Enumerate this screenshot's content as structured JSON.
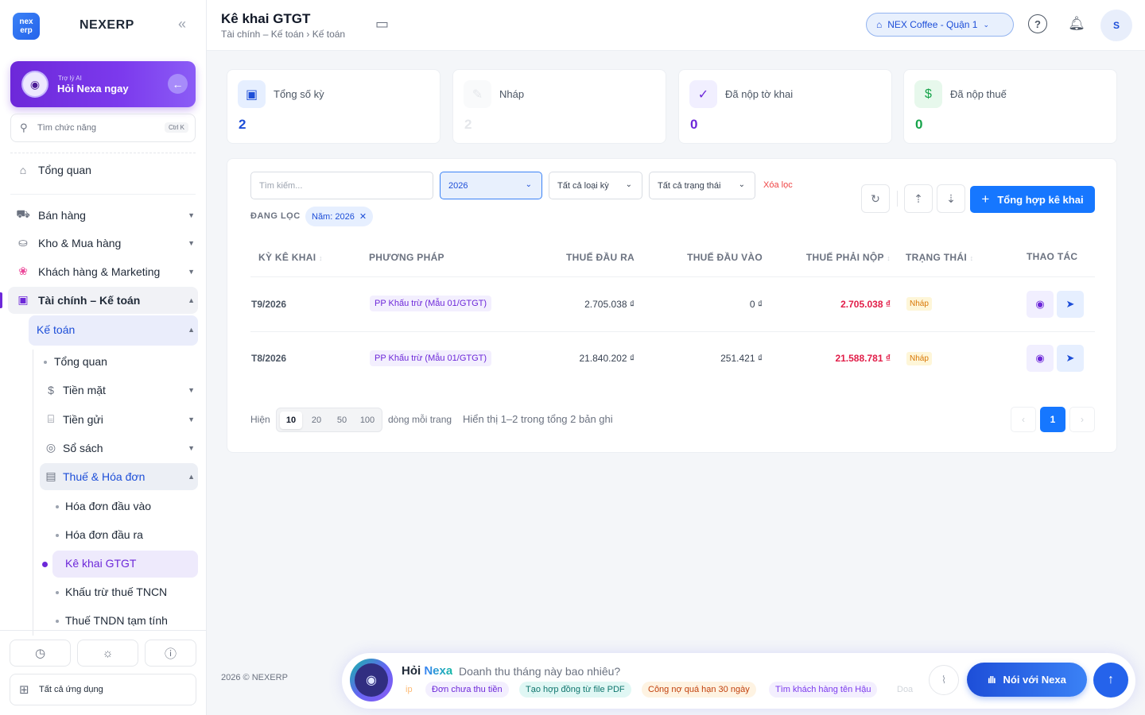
{
  "brand": {
    "logo": "nex erp",
    "name": "NEXERP"
  },
  "ai": {
    "small": "Trợ lý AI",
    "big": "Hỏi Nexa ngay"
  },
  "search": {
    "placeholder": "Tìm chức năng",
    "shortcut": "Ctrl K"
  },
  "nav": {
    "overview": "Tổng quan",
    "sales": "Bán hàng",
    "inventory": "Kho & Mua hàng",
    "customers": "Khách hàng & Marketing",
    "finance": "Tài chính – Kế toán",
    "accounting": "Kế toán",
    "acc_overview": "Tổng quan",
    "cash": "Tiền mặt",
    "deposit": "Tiền gửi",
    "books": "Sổ sách",
    "tax": "Thuế & Hóa đơn",
    "in_invoice": "Hóa đơn đầu vào",
    "out_invoice": "Hóa đơn đầu ra",
    "vat": "Kê khai GTGT",
    "pit": "Khấu trừ thuế TNCN",
    "cit": "Thuế TNDN tạm tính"
  },
  "sidebar_bottom": {
    "all_apps": "Tất cả ứng dụng"
  },
  "header": {
    "title": "Kê khai GTGT",
    "breadcrumb": "Tài chính – Kế toán › Kế toán",
    "store": "NEX Coffee - Quận 1",
    "avatar": "S"
  },
  "stats": [
    {
      "label": "Tổng số kỳ",
      "value": "2",
      "color": "#1d4ed8"
    },
    {
      "label": "Nháp",
      "value": "2",
      "color": "#d1d5db"
    },
    {
      "label": "Đã nộp tờ khai",
      "value": "0",
      "color": "#6d28d9"
    },
    {
      "label": "Đã nộp thuế",
      "value": "0",
      "color": "#16a34a"
    }
  ],
  "filters": {
    "search_placeholder": "Tìm kiếm...",
    "year": "2026",
    "period_type": "Tất cả loại kỳ",
    "status": "Tất cả trạng thái",
    "clear": "Xóa lọc",
    "filtering_label": "ĐANG LỌC",
    "chip": "Năm: 2026"
  },
  "toolbar": {
    "primary": "Tổng hợp kê khai"
  },
  "table": {
    "headers": [
      "KỲ KÊ KHAI",
      "PHƯƠNG PHÁP",
      "THUẾ ĐẦU RA",
      "THUẾ ĐẦU VÀO",
      "THUẾ PHẢI NỘP",
      "TRẠNG THÁI",
      "THAO TÁC"
    ],
    "rows": [
      {
        "period": "T9/2026",
        "method": "PP Khấu trừ (Mẫu 01/GTGT)",
        "out": "2.705.038 ₫",
        "in": "0 ₫",
        "pay": "2.705.038 ₫",
        "status": "Nháp"
      },
      {
        "period": "T8/2026",
        "method": "PP Khấu trừ (Mẫu 01/GTGT)",
        "out": "21.840.202 ₫",
        "in": "251.421 ₫",
        "pay": "21.588.781 ₫",
        "status": "Nháp"
      }
    ]
  },
  "pagination": {
    "show_label": "Hiện",
    "sizes": [
      "10",
      "20",
      "50",
      "100"
    ],
    "per_page": "dòng mỗi trang",
    "summary": "Hiển thị 1–2 trong tổng 2 bản ghi",
    "current": "1"
  },
  "footer": {
    "copyright": "2026 © NEXERP"
  },
  "nexa": {
    "ask": "Hỏi",
    "name": "Nexa",
    "question": "Doanh thu tháng này bao nhiêu?",
    "suggestions": [
      "ip",
      "Đơn chưa thu tiền",
      "Tạo hợp đồng từ file PDF",
      "Công nợ quá hạn 30 ngày",
      "Tìm khách hàng tên Hậu",
      "Doa"
    ],
    "talk": "Nói với Nexa"
  }
}
